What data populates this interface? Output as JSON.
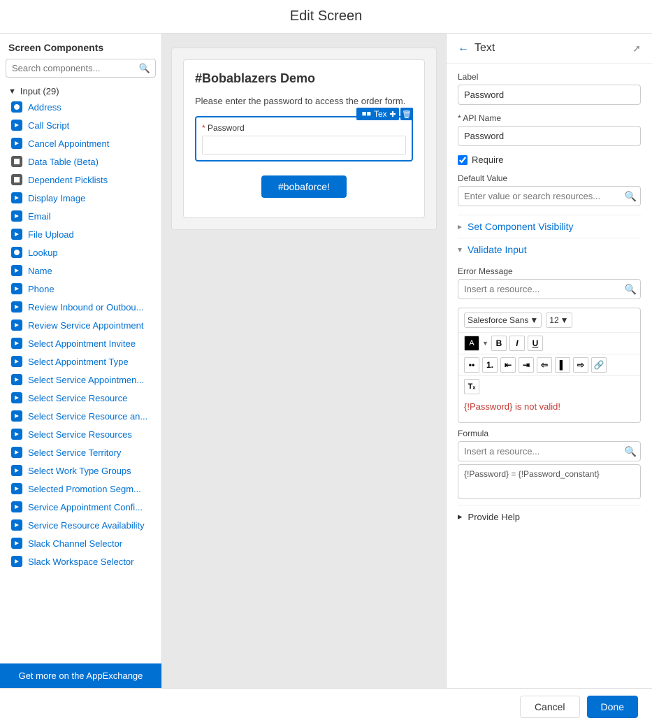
{
  "header": {
    "title": "Edit Screen"
  },
  "sidebar": {
    "title": "Screen Components",
    "search_placeholder": "Search components...",
    "section": {
      "label": "Input",
      "count": "29"
    },
    "items": [
      {
        "label": "Address"
      },
      {
        "label": "Call Script"
      },
      {
        "label": "Cancel Appointment"
      },
      {
        "label": "Data Table (Beta)"
      },
      {
        "label": "Dependent Picklists"
      },
      {
        "label": "Display Image"
      },
      {
        "label": "Email"
      },
      {
        "label": "File Upload"
      },
      {
        "label": "Lookup"
      },
      {
        "label": "Name"
      },
      {
        "label": "Phone"
      },
      {
        "label": "Review Inbound or Outbou..."
      },
      {
        "label": "Review Service Appointment"
      },
      {
        "label": "Select Appointment Invitee"
      },
      {
        "label": "Select Appointment Type"
      },
      {
        "label": "Select Service Appointmen..."
      },
      {
        "label": "Select Service Resource"
      },
      {
        "label": "Select Service Resource an..."
      },
      {
        "label": "Select Service Resources"
      },
      {
        "label": "Select Service Territory"
      },
      {
        "label": "Select Work Type Groups"
      },
      {
        "label": "Selected Promotion Segm..."
      },
      {
        "label": "Service Appointment Confi..."
      },
      {
        "label": "Service Resource Availability"
      },
      {
        "label": "Slack Channel Selector"
      },
      {
        "label": "Slack Workspace Selector"
      }
    ],
    "appexchange_label": "Get more on the AppExchange"
  },
  "canvas": {
    "form_title": "#Bobablazers Demo",
    "form_desc": "Please enter the password to access the order form.",
    "field_tooltip": "Text",
    "field_label": "* Password",
    "password_required_marker": "*",
    "password_label": "Password",
    "submit_button": "#bobaforce!"
  },
  "right_panel": {
    "back_icon": "←",
    "title": "Text",
    "expand_icon": "⤢",
    "label_field": {
      "label": "Label",
      "value": "Password"
    },
    "api_name_field": {
      "label": "* API Name",
      "required": true,
      "value": "Password"
    },
    "require_checkbox": {
      "label": "Require",
      "checked": true
    },
    "default_value": {
      "label": "Default Value",
      "placeholder": "Enter value or search resources..."
    },
    "set_visibility": {
      "label": "Set Component Visibility",
      "collapsed": true
    },
    "validate_input": {
      "label": "Validate Input",
      "expanded": true
    },
    "error_message": {
      "label": "Error Message",
      "placeholder": "Insert a resource..."
    },
    "error_text": "{!Password} is not valid!",
    "rich_text": {
      "font": "Salesforce Sans",
      "size": "12",
      "color": "#000000",
      "content": "{!Password} is not valid!"
    },
    "formula": {
      "label": "Formula",
      "placeholder": "Insert a resource...",
      "value": "{!Password} = {!Password_constant}"
    },
    "provide_help": {
      "label": "Provide Help",
      "collapsed": true
    }
  },
  "footer": {
    "cancel_label": "Cancel",
    "done_label": "Done"
  }
}
